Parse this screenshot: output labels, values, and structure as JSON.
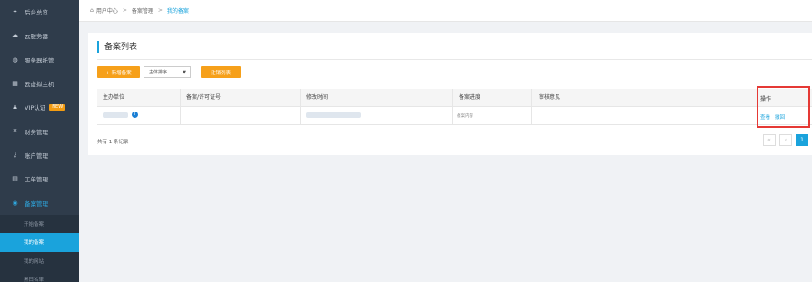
{
  "sidebar": {
    "items": [
      {
        "icon": "rocket-icon",
        "glyph": "✦",
        "label": "后台总览"
      },
      {
        "icon": "cloud-icon",
        "glyph": "☁",
        "label": "云服务器"
      },
      {
        "icon": "server-icon",
        "glyph": "◍",
        "label": "服务器托管"
      },
      {
        "icon": "host-icon",
        "glyph": "▦",
        "label": "云虚拟主机"
      },
      {
        "icon": "user-icon",
        "glyph": "♟",
        "label": "VIP认证",
        "badge": "NEW"
      },
      {
        "icon": "yen-icon",
        "glyph": "¥",
        "label": "财务管理"
      },
      {
        "icon": "key-icon",
        "glyph": "⚷",
        "label": "账户管理"
      },
      {
        "icon": "ticket-icon",
        "glyph": "▤",
        "label": "工单管理"
      },
      {
        "icon": "record-icon",
        "glyph": "◉",
        "label": "备案管理"
      }
    ],
    "sub_items": [
      {
        "label": "开始备案"
      },
      {
        "label": "我的备案"
      },
      {
        "label": "我的网站"
      },
      {
        "label": "黑白名单"
      }
    ]
  },
  "breadcrumb": {
    "home": "用户中心",
    "sep": ">",
    "middle": "备案管理",
    "current": "我的备案"
  },
  "panel": {
    "title": "备案列表",
    "new_button": "+ 新增备案",
    "sort_select": "主体排序",
    "cancel_button": "注销列表",
    "columns": [
      "主办单位",
      "备案/许可证号",
      "修改时间",
      "备案进度",
      "审核意见",
      "操作"
    ],
    "row": {
      "progress": "备案内容",
      "actions": [
        "查看",
        "撤回"
      ]
    },
    "total": "共有 1 条记录",
    "pagination": [
      "«",
      "‹",
      "1"
    ]
  },
  "colors": {
    "accent": "#1aa3dc",
    "orange": "#f6a01a",
    "highlight": "#e53935",
    "sidebar": "#2f3c4b"
  }
}
